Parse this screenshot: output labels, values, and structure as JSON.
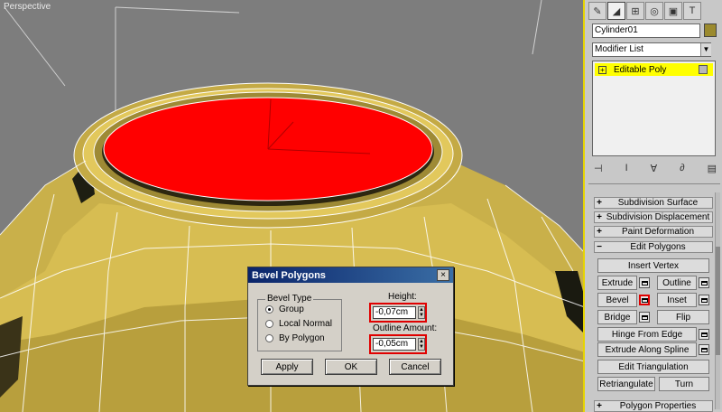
{
  "viewport": {
    "label": "Perspective"
  },
  "panel": {
    "tabs": [
      "create-icon",
      "modify-icon",
      "hierarchy-icon",
      "motion-icon",
      "display-icon",
      "utilities-icon"
    ],
    "object_name": "Cylinder01",
    "object_color": "#9b8a2e",
    "modifier_list": "Modifier List",
    "stack_item": "Editable Poly",
    "rollouts": {
      "subdivision_surface": "Subdivision Surface",
      "subdivision_displacement": "Subdivision Displacement",
      "paint_deformation": "Paint Deformation",
      "edit_polygons": "Edit Polygons",
      "polygon_properties": "Polygon Properties"
    },
    "buttons": {
      "insert_vertex": "Insert Vertex",
      "extrude": "Extrude",
      "outline": "Outline",
      "bevel": "Bevel",
      "inset": "Inset",
      "bridge": "Bridge",
      "flip": "Flip",
      "hinge_from_edge": "Hinge From Edge",
      "extrude_along_spline": "Extrude Along Spline",
      "edit_triangulation": "Edit Triangulation",
      "retriangulate": "Retriangulate",
      "turn": "Turn"
    }
  },
  "dialog": {
    "title": "Bevel Polygons",
    "bevel_type_label": "Bevel Type",
    "options": [
      "Group",
      "Local Normal",
      "By Polygon"
    ],
    "selected_option": "Group",
    "height_label": "Height:",
    "height_value": "-0,07cm",
    "outline_label": "Outline Amount:",
    "outline_value": "-0,05cm",
    "apply": "Apply",
    "ok": "OK",
    "cancel": "Cancel"
  },
  "colors": {
    "selection": "#ff0000",
    "mesh": "#c8b048",
    "highlight": "#ffff00",
    "title_bar": "#0a246a"
  }
}
